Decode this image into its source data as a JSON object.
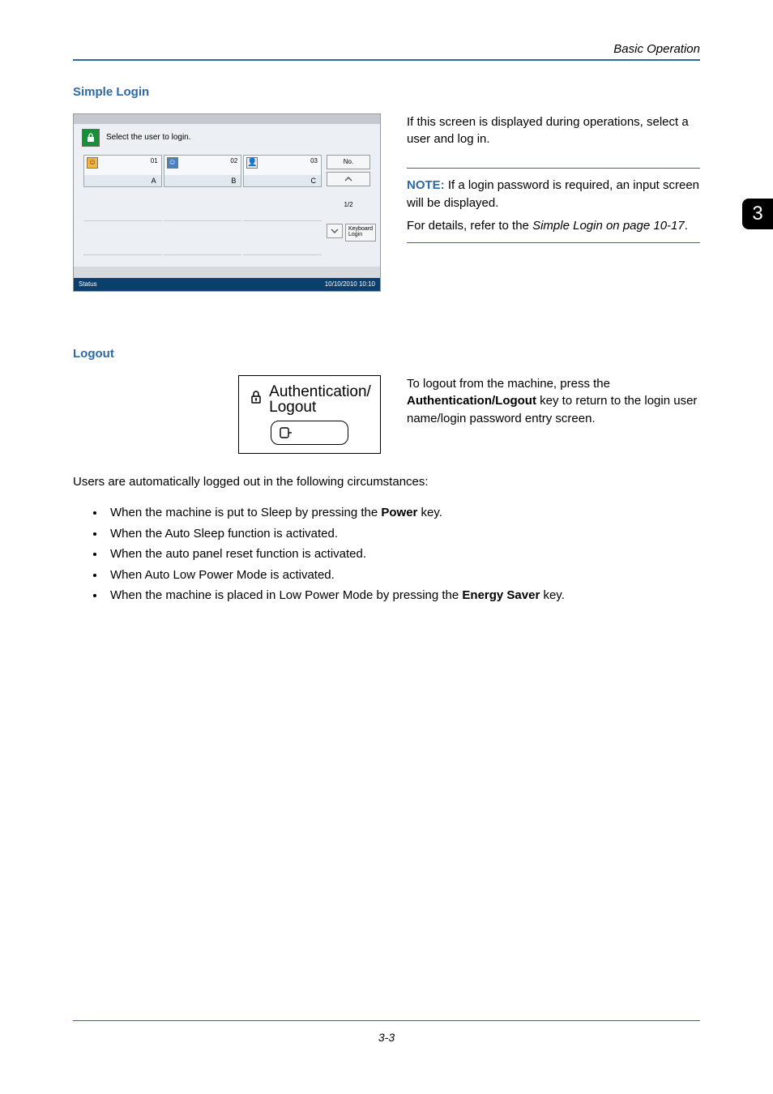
{
  "header": {
    "running_head": "Basic Operation",
    "side_tab": "3"
  },
  "simple_login": {
    "heading": "Simple Login",
    "panel": {
      "title": "Select the user to login.",
      "cards": [
        {
          "num": "01",
          "letter": "A"
        },
        {
          "num": "02",
          "letter": "B"
        },
        {
          "num": "03",
          "letter": "C"
        }
      ],
      "no_label": "No.",
      "page_indicator": "1/2",
      "keyboard_login": "Keyboard\nLogin",
      "status_left": "Status",
      "status_right": "10/10/2010  10:10"
    },
    "body_text": "If this screen is displayed during operations, select a user and log in.",
    "note": {
      "label": "NOTE:",
      "line1": " If a login password is required, an input screen will be displayed.",
      "line2_a": "For details, refer to the ",
      "line2_i": "Simple Login on page 10-17",
      "line2_b": "."
    }
  },
  "logout": {
    "heading": "Logout",
    "box_line1": "Authentication/",
    "box_line2": "Logout",
    "indicator_glyph": "⃞",
    "text_a": "To logout from the machine, press the ",
    "text_bold": "Authentication/Logout",
    "text_b": " key to return to the login user name/login password entry screen.",
    "intro": "Users are automatically logged out in the following circumstances:",
    "bullets": [
      {
        "pre": "When the machine is put to Sleep by pressing the ",
        "bold": "Power",
        "post": " key."
      },
      {
        "pre": "When the Auto Sleep function is activated.",
        "bold": "",
        "post": ""
      },
      {
        "pre": "When the auto panel reset function is activated.",
        "bold": "",
        "post": ""
      },
      {
        "pre": "When Auto Low Power Mode is activated.",
        "bold": "",
        "post": ""
      },
      {
        "pre": "When the machine is placed in Low Power Mode by pressing the ",
        "bold": "Energy Saver",
        "post": " key."
      }
    ]
  },
  "footer": {
    "page": "3-3"
  }
}
